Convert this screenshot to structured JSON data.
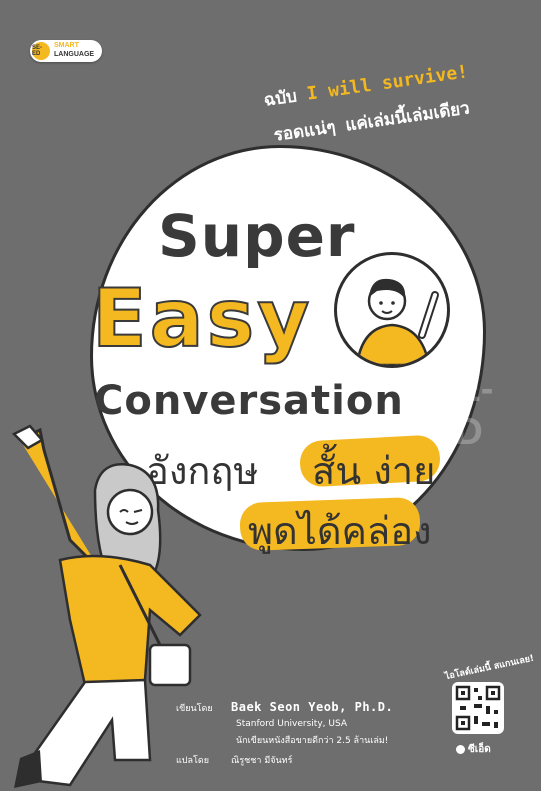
{
  "logo": {
    "badge": "SE-ED",
    "line1": "SMART",
    "line2": "LANGUAGE"
  },
  "tagline": {
    "line1_prefix": "ฉบับ ",
    "line1_en": "I will survive!",
    "line2": "รอดแน่ๆ แค่เล่มนี้เล่มเดียว"
  },
  "title": {
    "word1": "Super",
    "word2": "Easy",
    "word3": "Conversation"
  },
  "subtitle": {
    "part1": "อังกฤษ",
    "part2": "สั้น ง่าย",
    "part3": "พูดได้คล่อง"
  },
  "watermark": "SE-ED",
  "credits": {
    "author_label": "เขียนโดย",
    "author_name": "Baek Seon Yeob, Ph.D.",
    "author_affil": "Stanford University, USA",
    "author_note": "นักเขียนหนังสือขายดีกว่า 2.5 ล้านเล่ม!",
    "translator_label": "แปลโดย",
    "translator_name": "ณิรูชชา มีจันทร์"
  },
  "qr_hint": "ไอโลด์เล่มนี้ สแกนเลย!",
  "publisher": "ซีเอ็ด",
  "colors": {
    "accent": "#f4b820",
    "background": "#6e6e6e",
    "ink": "#3a3a3a"
  }
}
